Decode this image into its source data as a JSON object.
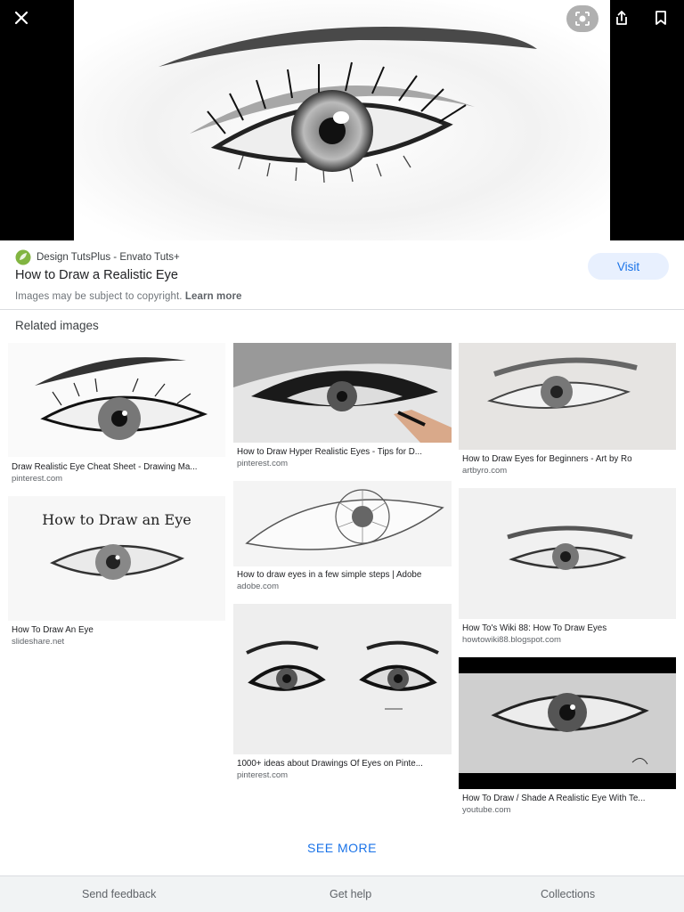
{
  "viewer": {
    "close_icon": "close-icon",
    "lens_icon": "lens-icon",
    "share_icon": "share-icon",
    "save_icon": "bookmark-icon"
  },
  "info": {
    "source_name": "Design TutsPlus - Envato Tuts+",
    "title": "How to Draw a Realistic Eye",
    "copyright_text": "Images may be subject to copyright.",
    "learn_more": "Learn more",
    "visit_label": "Visit"
  },
  "related": {
    "heading": "Related images",
    "items": [
      {
        "caption": "Draw Realistic Eye Cheat Sheet - Drawing Ma...",
        "domain": "pinterest.com"
      },
      {
        "caption": "How To Draw An Eye",
        "domain": "slideshare.net",
        "image_text": "How to Draw an Eye"
      },
      {
        "caption": "How to Draw Hyper Realistic Eyes - Tips for D...",
        "domain": "pinterest.com"
      },
      {
        "caption": "How to draw eyes in a few simple steps | Adobe",
        "domain": "adobe.com"
      },
      {
        "caption": "1000+ ideas about Drawings Of Eyes on Pinte...",
        "domain": "pinterest.com"
      },
      {
        "caption": "How to Draw Eyes for Beginners - Art by Ro",
        "domain": "artbyro.com"
      },
      {
        "caption": "How To's Wiki 88: How To Draw Eyes",
        "domain": "howtowiki88.blogspot.com"
      },
      {
        "caption": "How To Draw / Shade A Realistic Eye With Te...",
        "domain": "youtube.com"
      }
    ],
    "see_more": "SEE MORE"
  },
  "footer": {
    "send_feedback": "Send feedback",
    "get_help": "Get help",
    "collections": "Collections"
  }
}
